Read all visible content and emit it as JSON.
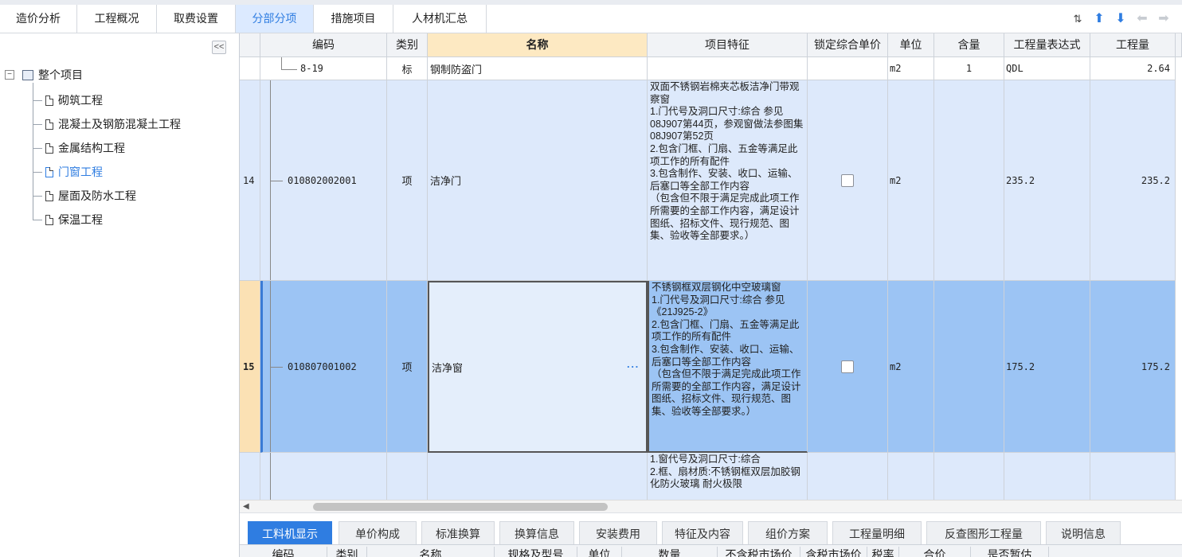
{
  "top_tabs": [
    {
      "label": "造价分析"
    },
    {
      "label": "工程概况"
    },
    {
      "label": "取费设置"
    },
    {
      "label": "分部分项"
    },
    {
      "label": "措施项目"
    },
    {
      "label": "人材机汇总"
    }
  ],
  "active_top_tab": "分部分项",
  "toolbar_icons": [
    "sort-icon",
    "arrow-up-icon",
    "arrow-down-icon",
    "arrow-left-icon",
    "arrow-right-icon"
  ],
  "tree": {
    "collapse_label": "<<",
    "root": {
      "label": "整个项目",
      "toggle": "⊟"
    },
    "items": [
      {
        "label": "砌筑工程"
      },
      {
        "label": "混凝土及钢筋混凝土工程"
      },
      {
        "label": "金属结构工程"
      },
      {
        "label": "门窗工程"
      },
      {
        "label": "屋面及防水工程"
      },
      {
        "label": "保温工程"
      }
    ],
    "selected": "门窗工程"
  },
  "grid": {
    "headers": {
      "code": "编码",
      "type": "类别",
      "name": "名称",
      "features": "项目特征",
      "lock_price": "锁定综合单价",
      "unit": "单位",
      "content": "含量",
      "qty_expr": "工程量表达式",
      "qty": "工程量"
    },
    "rows": [
      {
        "num": "",
        "code": "8-19",
        "type": "标",
        "name": "钢制防盗门",
        "features": "",
        "unit": "m2",
        "content": "1",
        "qty_expr": "QDL",
        "qty": "2.64"
      },
      {
        "num": "14",
        "code": "010802002001",
        "type": "项",
        "name": "洁净门",
        "features": "双面不锈钢岩棉夹芯板洁净门带观察窗\n1.门代号及洞口尺寸:综合 参见08J907第44页，参观窗做法参图集08J907第52页\n2.包含门框、门扇、五金等满足此项工作的所有配件\n3.包含制作、安装、收口、运输、后塞口等全部工作内容\n（包含但不限于满足完成此项工作所需要的全部工作内容，满足设计图纸、招标文件、现行规范、图集、验收等全部要求。）",
        "unit": "m2",
        "content": "",
        "qty_expr": "235.2",
        "qty": "235.2"
      },
      {
        "num": "15",
        "code": "010807001002",
        "type": "项",
        "name": "洁净窗",
        "name_ellipsis": "···",
        "features": "不锈钢框双层钢化中空玻璃窗\n1.门代号及洞口尺寸:综合 参见《21J925-2》\n2.包含门框、门扇、五金等满足此项工作的所有配件\n3.包含制作、安装、收口、运输、后塞口等全部工作内容\n（包含但不限于满足完成此项工作所需要的全部工作内容，满足设计图纸、招标文件、现行规范、图集、验收等全部要求。）",
        "unit": "m2",
        "content": "",
        "qty_expr": "175.2",
        "qty": "175.2"
      },
      {
        "num": "",
        "code": "",
        "type": "",
        "name": "",
        "features": "1.窗代号及洞口尺寸:综合\n2.框、扇材质:不锈钢框双层加胶钢化防火玻璃 耐火极限",
        "unit": "",
        "content": "",
        "qty_expr": "",
        "qty": ""
      }
    ]
  },
  "bottom_tabs": [
    {
      "label": "工料机显示"
    },
    {
      "label": "单价构成"
    },
    {
      "label": "标准换算"
    },
    {
      "label": "换算信息"
    },
    {
      "label": "安装费用"
    },
    {
      "label": "特征及内容"
    },
    {
      "label": "组价方案"
    },
    {
      "label": "工程量明细"
    },
    {
      "label": "反查图形工程量"
    },
    {
      "label": "说明信息"
    }
  ],
  "active_bottom_tab": "工料机显示",
  "bottom_headers": [
    "编码",
    "类别",
    "名称",
    "规格及型号",
    "单位",
    "数量",
    "不含税市场价",
    "含税市场价",
    "税率",
    "合价",
    "是否暂估"
  ]
}
